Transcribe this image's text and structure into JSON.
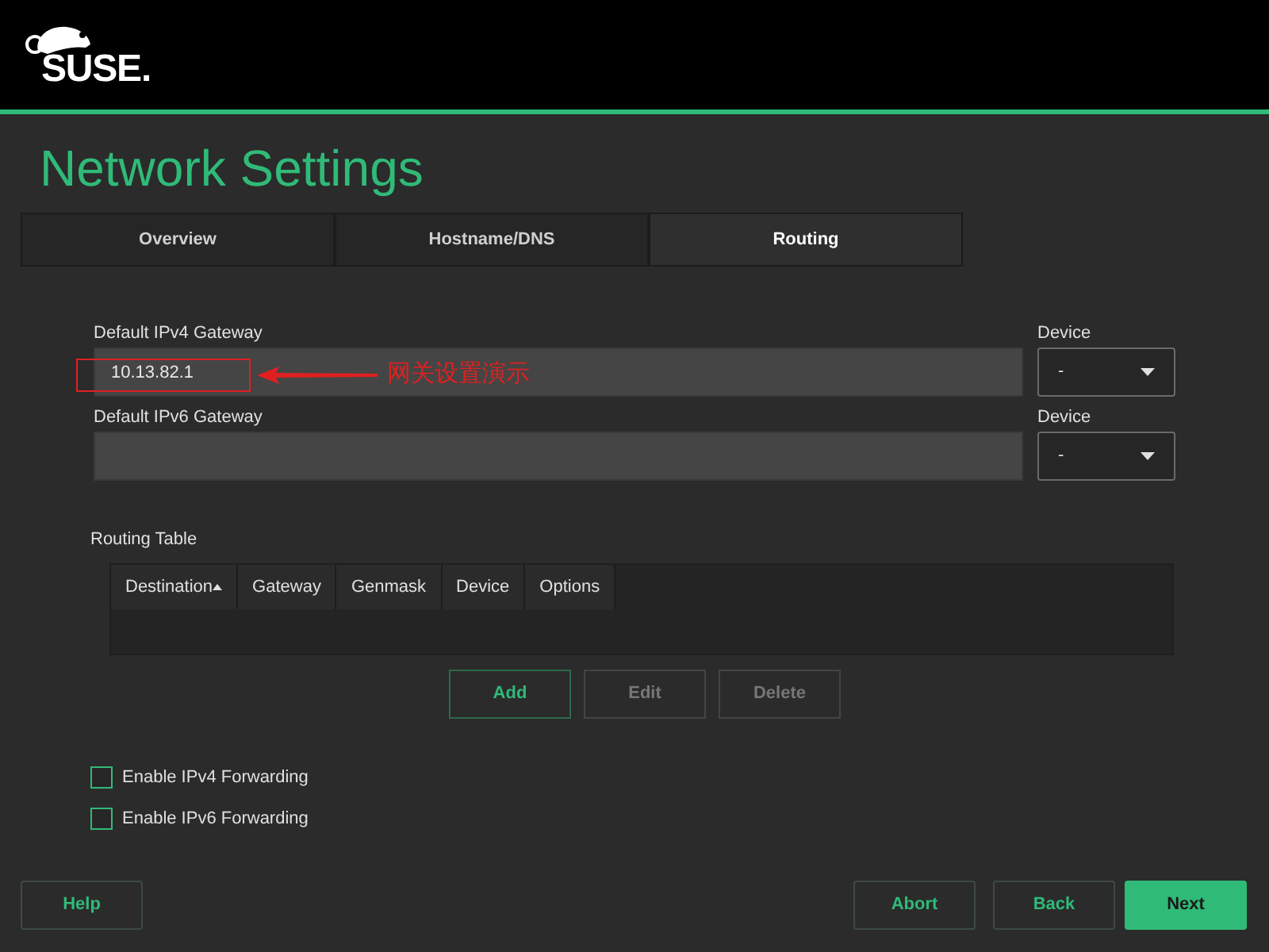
{
  "logo": {
    "wordmark": "SUSE."
  },
  "title": "Network Settings",
  "tabs": [
    {
      "label": "Overview",
      "selected": false
    },
    {
      "label": "Hostname/DNS",
      "selected": false
    },
    {
      "label": "Routing",
      "selected": true
    }
  ],
  "gateways": [
    {
      "label": "Default IPv4 Gateway",
      "value": "10.13.82.1",
      "device_label": "Device",
      "device_value": "-"
    },
    {
      "label": "Default IPv6 Gateway",
      "device_label": "Device",
      "device_value": "-"
    }
  ],
  "annotation": {
    "text": "网关设置演示"
  },
  "routing_table": {
    "label": "Routing Table",
    "columns": [
      {
        "label": "Destination",
        "sorted": true
      },
      {
        "label": "Gateway",
        "sorted": false
      },
      {
        "label": "Genmask",
        "sorted": false
      },
      {
        "label": "Device",
        "sorted": false
      },
      {
        "label": "Options",
        "sorted": false
      }
    ]
  },
  "table_buttons": [
    {
      "label": "Add",
      "disabled": false
    },
    {
      "label": "Edit",
      "disabled": true
    },
    {
      "label": "Delete",
      "disabled": true
    }
  ],
  "checkboxes": [
    {
      "label": "Enable IPv4 Forwarding",
      "checked": false
    },
    {
      "label": "Enable IPv6 Forwarding",
      "checked": false
    }
  ],
  "footer_buttons": [
    {
      "label": "Help",
      "kind": "secondary"
    },
    {
      "label": "Abort",
      "kind": "secondary"
    },
    {
      "label": "Back",
      "kind": "secondary"
    },
    {
      "label": "Next",
      "kind": "primary"
    }
  ]
}
